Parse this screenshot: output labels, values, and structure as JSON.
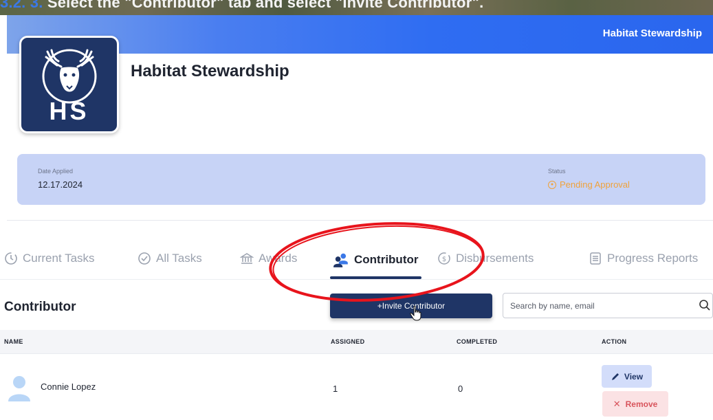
{
  "caption": {
    "number": "3.2. 3.",
    "text": " Select the \"Contributor\" tab and select \"Invite Contributor\"."
  },
  "header": {
    "app_name": "Habitat Stewardship"
  },
  "logo": {
    "letters": "HS"
  },
  "page": {
    "title": "Habitat Stewardship"
  },
  "info": {
    "date_label": "Date Applied",
    "date_value": "12.17.2024",
    "status_label": "Status",
    "status_value": "Pending Approval",
    "status_color": "#f0a23a"
  },
  "tabs": [
    {
      "label": "Current Tasks",
      "icon": "clock-icon",
      "active": false
    },
    {
      "label": "All Tasks",
      "icon": "check-circle-icon",
      "active": false
    },
    {
      "label": "Awards",
      "icon": "bank-icon",
      "active": false
    },
    {
      "label": "Contributor",
      "icon": "people-icon",
      "active": true
    },
    {
      "label": "Disbursements",
      "icon": "dollar-circle-icon",
      "active": false
    },
    {
      "label": "Progress Reports",
      "icon": "list-icon",
      "active": false
    }
  ],
  "section": {
    "title": "Contributor"
  },
  "invite_button": {
    "label": "+Invite Contributor"
  },
  "search": {
    "placeholder": "Search by name, email",
    "value": ""
  },
  "table": {
    "columns": [
      "NAME",
      "ASSIGNED",
      "COMPLETED",
      "ACTION"
    ],
    "rows": [
      {
        "name": "Connie Lopez",
        "assigned": "1",
        "completed": "0",
        "view_label": "View",
        "remove_label": "Remove"
      }
    ]
  },
  "colors": {
    "brand_navy": "#1f3566",
    "header_blue": "#2f6df2",
    "info_card": "#c7d3f6",
    "annotation_red": "#e8141c"
  }
}
